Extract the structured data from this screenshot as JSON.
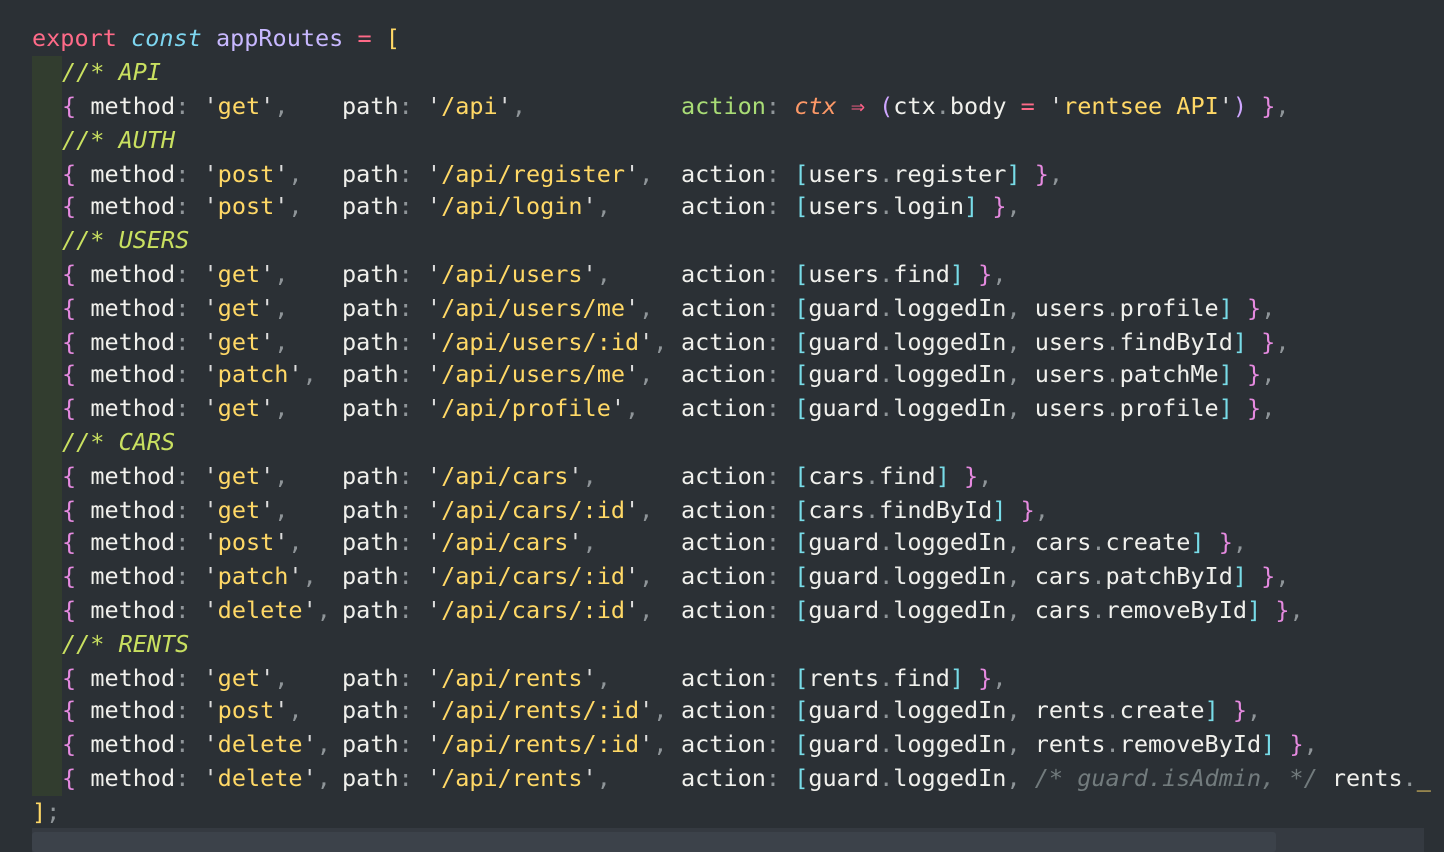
{
  "header": {
    "export_kw": "export",
    "const_kw": "const",
    "name": "appRoutes",
    "equals": "=",
    "open_bracket": "["
  },
  "footer": {
    "close_bracket": "]",
    "semicolon": ";"
  },
  "lines": [
    {
      "kind": "comment",
      "text": "//* API"
    },
    {
      "kind": "route",
      "method": "get",
      "path": "/api",
      "action_raw": "api"
    },
    {
      "kind": "comment",
      "text": "//* AUTH"
    },
    {
      "kind": "route",
      "method": "post",
      "path": "/api/register",
      "action": [
        "users.register"
      ]
    },
    {
      "kind": "route",
      "method": "post",
      "path": "/api/login",
      "action": [
        "users.login"
      ]
    },
    {
      "kind": "comment",
      "text": "//* USERS"
    },
    {
      "kind": "route",
      "method": "get",
      "path": "/api/users",
      "action": [
        "users.find"
      ]
    },
    {
      "kind": "route",
      "method": "get",
      "path": "/api/users/me",
      "action": [
        "guard.loggedIn",
        "users.profile"
      ]
    },
    {
      "kind": "route",
      "method": "get",
      "path": "/api/users/:id",
      "action": [
        "guard.loggedIn",
        "users.findById"
      ]
    },
    {
      "kind": "route",
      "method": "patch",
      "path": "/api/users/me",
      "action": [
        "guard.loggedIn",
        "users.patchMe"
      ]
    },
    {
      "kind": "route",
      "method": "get",
      "path": "/api/profile",
      "action": [
        "guard.loggedIn",
        "users.profile"
      ]
    },
    {
      "kind": "comment",
      "text": "//* CARS"
    },
    {
      "kind": "route",
      "method": "get",
      "path": "/api/cars",
      "action": [
        "cars.find"
      ]
    },
    {
      "kind": "route",
      "method": "get",
      "path": "/api/cars/:id",
      "action": [
        "cars.findById"
      ]
    },
    {
      "kind": "route",
      "method": "post",
      "path": "/api/cars",
      "action": [
        "guard.loggedIn",
        "cars.create"
      ]
    },
    {
      "kind": "route",
      "method": "patch",
      "path": "/api/cars/:id",
      "action": [
        "guard.loggedIn",
        "cars.patchById"
      ]
    },
    {
      "kind": "route",
      "method": "delete",
      "path": "/api/cars/:id",
      "action": [
        "guard.loggedIn",
        "cars.removeById"
      ]
    },
    {
      "kind": "comment",
      "text": "//* RENTS"
    },
    {
      "kind": "route",
      "method": "get",
      "path": "/api/rents",
      "action": [
        "rents.find"
      ]
    },
    {
      "kind": "route",
      "method": "post",
      "path": "/api/rents/:id",
      "action": [
        "guard.loggedIn",
        "rents.create"
      ]
    },
    {
      "kind": "route",
      "method": "delete",
      "path": "/api/rents/:id",
      "action": [
        "guard.loggedIn",
        "rents.removeById"
      ]
    },
    {
      "kind": "route",
      "method": "delete",
      "path": "/api/rents",
      "action": [
        "guard.loggedIn"
      ],
      "inline_comment": "/* guard.isAdmin, */",
      "tail": "rents."
    }
  ],
  "api_action": {
    "param": "ctx",
    "arrow": "⇒",
    "obj": "ctx",
    "prop": "body",
    "eq": "=",
    "value": "rentsee API"
  },
  "tokens": {
    "method_key": "method",
    "path_key": "path",
    "action_key": "action",
    "colon": ":",
    "comma": ",",
    "quote": "'",
    "open_brace": "{",
    "close_brace": "}",
    "open_arr": "[",
    "close_arr": "]",
    "dot": ".",
    "open_paren": "(",
    "close_paren": ")",
    "cursor": "_"
  },
  "colors": {
    "background": "#2b3035",
    "keyword": "#ff6a88",
    "string": "#ffd866",
    "comment": "#c9e060",
    "brace": "#e68ae0",
    "array_bracket": "#78dce8"
  }
}
